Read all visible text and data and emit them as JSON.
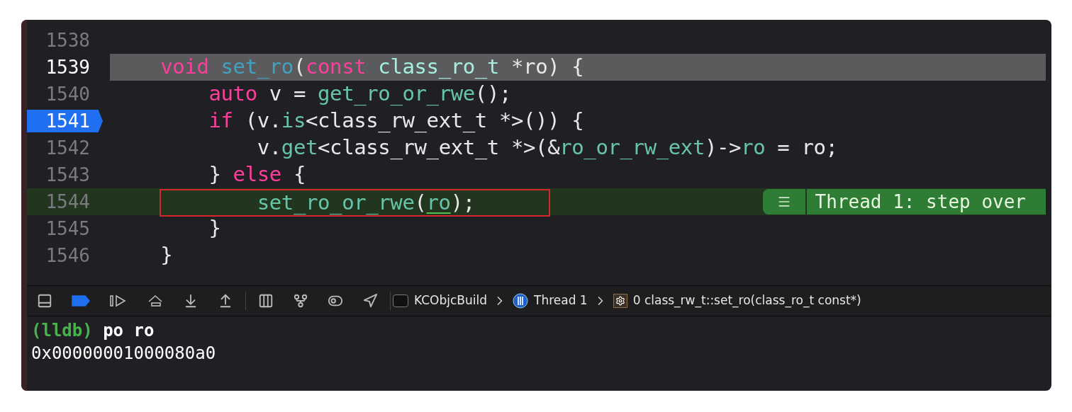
{
  "editor": {
    "lines": [
      {
        "number": "1538",
        "highlighted": false,
        "breakpoint": false,
        "current": false,
        "outlined": false
      },
      {
        "number": "1539",
        "highlighted": true,
        "breakpoint": false,
        "current": false,
        "outlined": false,
        "tokens": [
          {
            "kind": "keyword",
            "text": "    void"
          },
          {
            "kind": "decl",
            "text": " set_ro"
          },
          {
            "kind": "plain",
            "text": "("
          },
          {
            "kind": "keyword",
            "text": "const"
          },
          {
            "kind": "type",
            "text": " class_ro_t"
          },
          {
            "kind": "plain",
            "text": " *ro) {"
          }
        ]
      },
      {
        "number": "1540",
        "highlighted": false,
        "breakpoint": false,
        "current": false,
        "outlined": false,
        "tokens": [
          {
            "kind": "keyword",
            "text": "        auto"
          },
          {
            "kind": "plain",
            "text": " v = "
          },
          {
            "kind": "member",
            "text": "get_ro_or_rwe"
          },
          {
            "kind": "plain",
            "text": "();"
          }
        ]
      },
      {
        "number": "1541",
        "highlighted": false,
        "breakpoint": true,
        "current": false,
        "outlined": false,
        "tokens": [
          {
            "kind": "keyword",
            "text": "        if"
          },
          {
            "kind": "plain",
            "text": " (v."
          },
          {
            "kind": "member",
            "text": "is"
          },
          {
            "kind": "plain",
            "text": "<class_rw_ext_t *>()) {"
          }
        ]
      },
      {
        "number": "1542",
        "highlighted": false,
        "breakpoint": false,
        "current": false,
        "outlined": false,
        "tokens": [
          {
            "kind": "plain",
            "text": "            v."
          },
          {
            "kind": "member",
            "text": "get"
          },
          {
            "kind": "plain",
            "text": "<class_rw_ext_t *>(&"
          },
          {
            "kind": "member",
            "text": "ro_or_rw_ext"
          },
          {
            "kind": "plain",
            "text": ")->"
          },
          {
            "kind": "member",
            "text": "ro"
          },
          {
            "kind": "plain",
            "text": " = ro;"
          }
        ]
      },
      {
        "number": "1543",
        "highlighted": false,
        "breakpoint": false,
        "current": false,
        "outlined": false,
        "tokens": [
          {
            "kind": "plain",
            "text": "        } "
          },
          {
            "kind": "keyword",
            "text": "else"
          },
          {
            "kind": "plain",
            "text": " {"
          }
        ]
      },
      {
        "number": "1544",
        "highlighted": false,
        "breakpoint": false,
        "current": true,
        "outlined": true,
        "tokens": [
          {
            "kind": "member",
            "text": "            set_ro_or_rwe"
          },
          {
            "kind": "plain",
            "text": "("
          },
          {
            "kind": "underlined",
            "text": "ro"
          },
          {
            "kind": "plain",
            "text": ");"
          }
        ]
      },
      {
        "number": "1545",
        "highlighted": false,
        "breakpoint": false,
        "current": false,
        "outlined": false,
        "tokens": [
          {
            "kind": "plain",
            "text": "        }"
          }
        ]
      },
      {
        "number": "1546",
        "highlighted": false,
        "breakpoint": false,
        "current": false,
        "outlined": false,
        "tokens": [
          {
            "kind": "plain",
            "text": "    }"
          }
        ]
      }
    ],
    "thread_badge": {
      "label": "Thread 1: step over"
    }
  },
  "debug_bar": {
    "breakpoints_active": true,
    "breadcrumbs": [
      {
        "kind": "project",
        "label": "KCObjcBuild"
      },
      {
        "kind": "thread",
        "label": "Thread 1"
      },
      {
        "kind": "frame",
        "label": "0 class_rw_t::set_ro(class_ro_t const*)"
      }
    ]
  },
  "console": {
    "prompt": "(lldb)",
    "command": "po ro",
    "output": "0x00000001000080a0"
  }
}
